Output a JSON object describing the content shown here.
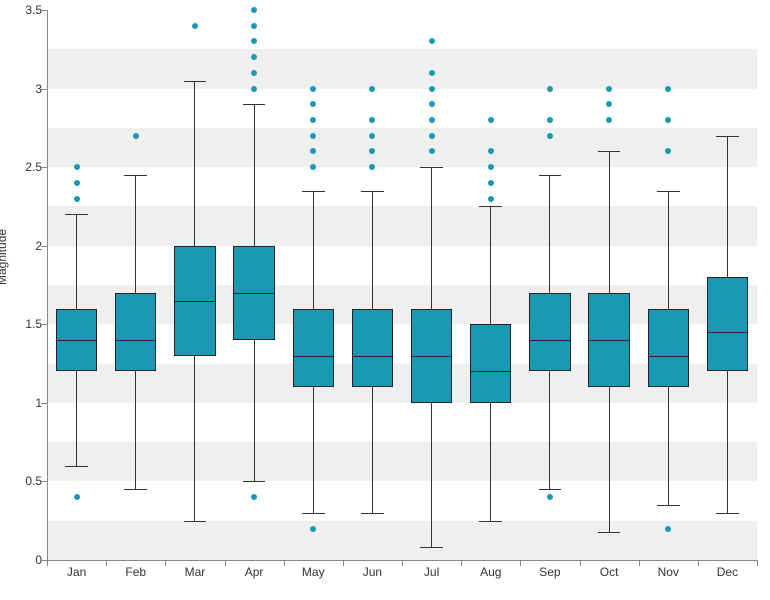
{
  "chart_data": {
    "type": "box",
    "ylabel": "Magnitude",
    "xlabel": "",
    "yticks": [
      0,
      0.5,
      1,
      1.5,
      2,
      2.5,
      3,
      3.5
    ],
    "ylim": [
      0,
      3.5
    ],
    "categories": [
      "Jan",
      "Feb",
      "Mar",
      "Apr",
      "May",
      "Jun",
      "Jul",
      "Aug",
      "Sep",
      "Oct",
      "Nov",
      "Dec"
    ],
    "series": [
      {
        "name": "Jan",
        "min": 0.6,
        "q1": 1.2,
        "median": 1.4,
        "q3": 1.6,
        "max": 2.2,
        "outliers": [
          0.4,
          2.3,
          2.4,
          2.5
        ]
      },
      {
        "name": "Feb",
        "min": 0.45,
        "q1": 1.2,
        "median": 1.4,
        "q3": 1.7,
        "max": 2.45,
        "outliers": [
          2.7
        ]
      },
      {
        "name": "Mar",
        "min": 0.25,
        "q1": 1.3,
        "median": 1.65,
        "q3": 2.0,
        "max": 3.05,
        "outliers": [
          3.4
        ]
      },
      {
        "name": "Apr",
        "min": 0.5,
        "q1": 1.4,
        "median": 1.7,
        "q3": 2.0,
        "max": 2.9,
        "outliers": [
          0.4,
          3.0,
          3.1,
          3.2,
          3.3,
          3.4,
          3.5
        ]
      },
      {
        "name": "May",
        "min": 0.3,
        "q1": 1.1,
        "median": 1.3,
        "q3": 1.6,
        "max": 2.35,
        "outliers": [
          0.2,
          2.5,
          2.6,
          2.7,
          2.8,
          2.9,
          3.0
        ]
      },
      {
        "name": "Jun",
        "min": 0.3,
        "q1": 1.1,
        "median": 1.3,
        "q3": 1.6,
        "max": 2.35,
        "outliers": [
          2.5,
          2.6,
          2.7,
          2.8,
          3.0
        ]
      },
      {
        "name": "Jul",
        "min": 0.08,
        "q1": 1.0,
        "median": 1.3,
        "q3": 1.6,
        "max": 2.5,
        "outliers": [
          2.6,
          2.7,
          2.8,
          2.9,
          3.0,
          3.1,
          3.3
        ]
      },
      {
        "name": "Aug",
        "min": 0.25,
        "q1": 1.0,
        "median": 1.2,
        "q3": 1.5,
        "max": 2.25,
        "outliers": [
          2.3,
          2.4,
          2.5,
          2.6,
          2.8
        ]
      },
      {
        "name": "Sep",
        "min": 0.45,
        "q1": 1.2,
        "median": 1.4,
        "q3": 1.7,
        "max": 2.45,
        "outliers": [
          0.4,
          2.7,
          2.8,
          3.0
        ]
      },
      {
        "name": "Oct",
        "min": 0.18,
        "q1": 1.1,
        "median": 1.4,
        "q3": 1.7,
        "max": 2.6,
        "outliers": [
          2.8,
          2.9,
          3.0
        ]
      },
      {
        "name": "Nov",
        "min": 0.35,
        "q1": 1.1,
        "median": 1.3,
        "q3": 1.6,
        "max": 2.35,
        "outliers": [
          0.2,
          2.6,
          2.8,
          3.0
        ]
      },
      {
        "name": "Dec",
        "min": 0.3,
        "q1": 1.2,
        "median": 1.45,
        "q3": 1.8,
        "max": 2.7,
        "outliers": []
      }
    ],
    "box_color": "#1999b3"
  }
}
